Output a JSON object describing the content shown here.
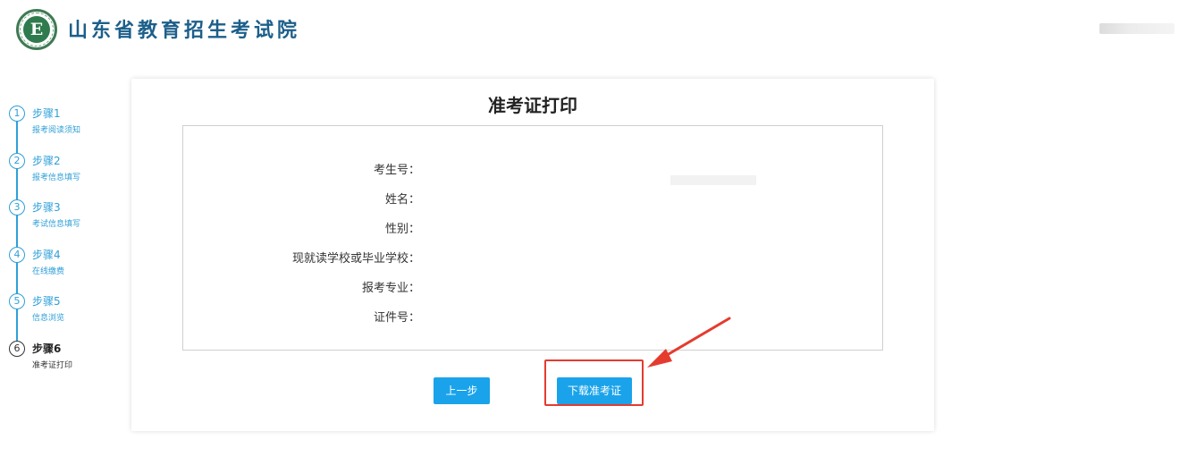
{
  "header": {
    "logo_letter": "E",
    "site_title": "山东省教育招生考试院"
  },
  "steps": [
    {
      "number": "1",
      "title": "步骤1",
      "subtitle": "报考阅读须知"
    },
    {
      "number": "2",
      "title": "步骤2",
      "subtitle": "报考信息填写"
    },
    {
      "number": "3",
      "title": "步骤3",
      "subtitle": "考试信息填写"
    },
    {
      "number": "4",
      "title": "步骤4",
      "subtitle": "在线缴费"
    },
    {
      "number": "5",
      "title": "步骤5",
      "subtitle": "信息浏览"
    },
    {
      "number": "6",
      "title": "步骤6",
      "subtitle": "准考证打印"
    }
  ],
  "current_step": 6,
  "card": {
    "title": "准考证打印",
    "fields": [
      {
        "label": "考生号："
      },
      {
        "label": "姓名："
      },
      {
        "label": "性别："
      },
      {
        "label": "现就读学校或毕业学校："
      },
      {
        "label": "报考专业："
      },
      {
        "label": "证件号："
      }
    ],
    "prev_button": "上一步",
    "download_button": "下载准考证"
  },
  "colors": {
    "accent": "#1aa3ea",
    "step_blue": "#2f9fd8",
    "highlight_red": "#e53b2f",
    "title_blue": "#1c5f8a"
  }
}
